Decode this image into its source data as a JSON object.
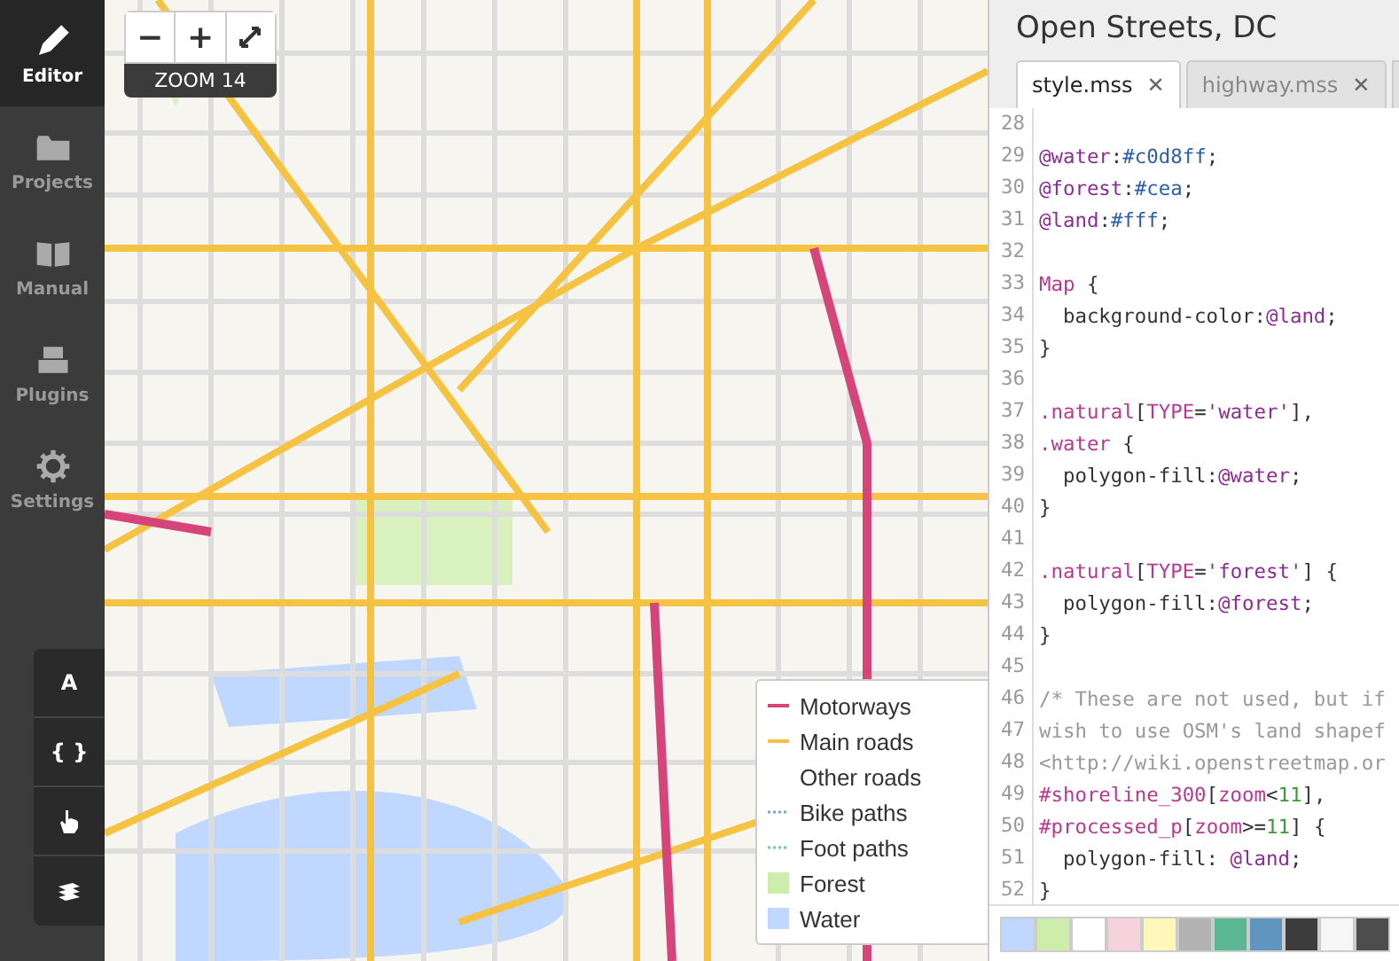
{
  "sidebar": {
    "items": [
      {
        "label": "Editor",
        "selected": true
      },
      {
        "label": "Projects",
        "selected": false
      },
      {
        "label": "Manual",
        "selected": false
      },
      {
        "label": "Plugins",
        "selected": false
      },
      {
        "label": "Settings",
        "selected": false
      }
    ],
    "tools": [
      {
        "kind": "text",
        "label": "A"
      },
      {
        "kind": "text",
        "label": "{ }"
      },
      {
        "kind": "hand"
      },
      {
        "kind": "layers"
      }
    ]
  },
  "map": {
    "zoom_controls": {
      "zoom_out": "−",
      "zoom_in": "+",
      "zoom_label": "ZOOM 14"
    },
    "legend": [
      {
        "label": "Motorways",
        "kind": "line",
        "color": "#d6457a"
      },
      {
        "label": "Main roads",
        "kind": "line",
        "color": "#f5c242"
      },
      {
        "label": "Other roads",
        "kind": "none"
      },
      {
        "label": "Bike paths",
        "kind": "dotted",
        "color": "#7aa6c8"
      },
      {
        "label": "Foot paths",
        "kind": "dotted",
        "color": "#7cc4a4"
      },
      {
        "label": "Forest",
        "kind": "fill",
        "color": "#cceeaa"
      },
      {
        "label": "Water",
        "kind": "fill",
        "color": "#c0d8ff"
      }
    ]
  },
  "editor": {
    "title": "Open Streets, DC",
    "tabs": [
      {
        "label": "style.mss",
        "close": "✕",
        "selected": true
      },
      {
        "label": "highway.mss",
        "close": "✕",
        "selected": false
      }
    ],
    "lines": [
      {
        "number": "28"
      },
      {
        "number": "29",
        "tokens": [
          {
            "kind": "var",
            "text": "@water"
          },
          {
            "kind": "plain",
            "text": ":"
          },
          {
            "kind": "value",
            "text": "#c0d8ff"
          },
          {
            "kind": "plain",
            "text": ";"
          }
        ]
      },
      {
        "number": "30",
        "tokens": [
          {
            "kind": "var",
            "text": "@forest"
          },
          {
            "kind": "plain",
            "text": ":"
          },
          {
            "kind": "value",
            "text": "#cea"
          },
          {
            "kind": "plain",
            "text": ";"
          }
        ]
      },
      {
        "number": "31",
        "tokens": [
          {
            "kind": "var",
            "text": "@land"
          },
          {
            "kind": "plain",
            "text": ":"
          },
          {
            "kind": "value",
            "text": "#fff"
          },
          {
            "kind": "plain",
            "text": ";"
          }
        ]
      },
      {
        "number": "32"
      },
      {
        "number": "33",
        "tokens": [
          {
            "kind": "selector",
            "text": "Map"
          },
          {
            "kind": "plain",
            "text": " {"
          }
        ]
      },
      {
        "number": "34",
        "tokens": [
          {
            "kind": "plain",
            "text": "  background-color:"
          },
          {
            "kind": "var",
            "text": "@land"
          },
          {
            "kind": "plain",
            "text": ";"
          }
        ]
      },
      {
        "number": "35",
        "tokens": [
          {
            "kind": "plain",
            "text": "}"
          }
        ]
      },
      {
        "number": "36"
      },
      {
        "number": "37",
        "tokens": [
          {
            "kind": "selector",
            "text": ".natural"
          },
          {
            "kind": "plain",
            "text": "["
          },
          {
            "kind": "selector",
            "text": "TYPE"
          },
          {
            "kind": "plain",
            "text": "="
          },
          {
            "kind": "string",
            "text": "'water'"
          },
          {
            "kind": "plain",
            "text": "],"
          }
        ]
      },
      {
        "number": "38",
        "tokens": [
          {
            "kind": "selector",
            "text": ".water"
          },
          {
            "kind": "plain",
            "text": " {"
          }
        ]
      },
      {
        "number": "39",
        "tokens": [
          {
            "kind": "plain",
            "text": "  polygon-fill:"
          },
          {
            "kind": "var",
            "text": "@water"
          },
          {
            "kind": "plain",
            "text": ";"
          }
        ]
      },
      {
        "number": "40",
        "tokens": [
          {
            "kind": "plain",
            "text": "}"
          }
        ]
      },
      {
        "number": "41"
      },
      {
        "number": "42",
        "tokens": [
          {
            "kind": "selector",
            "text": ".natural"
          },
          {
            "kind": "plain",
            "text": "["
          },
          {
            "kind": "selector",
            "text": "TYPE"
          },
          {
            "kind": "plain",
            "text": "="
          },
          {
            "kind": "string",
            "text": "'forest'"
          },
          {
            "kind": "plain",
            "text": "] {"
          }
        ]
      },
      {
        "number": "43",
        "tokens": [
          {
            "kind": "plain",
            "text": "  polygon-fill:"
          },
          {
            "kind": "var",
            "text": "@forest"
          },
          {
            "kind": "plain",
            "text": ";"
          }
        ]
      },
      {
        "number": "44",
        "tokens": [
          {
            "kind": "plain",
            "text": "}"
          }
        ]
      },
      {
        "number": "45"
      },
      {
        "number": "46",
        "tokens": [
          {
            "kind": "comment",
            "text": "/* These are not used, but if"
          }
        ]
      },
      {
        "number": "47",
        "tokens": [
          {
            "kind": "comment",
            "text": "wish to use OSM's land shapef"
          }
        ]
      },
      {
        "number": "48",
        "tokens": [
          {
            "kind": "comment",
            "text": "<http://wiki.openstreetmap.or"
          }
        ]
      },
      {
        "number": "49",
        "tokens": [
          {
            "kind": "selector",
            "text": "#shoreline_300"
          },
          {
            "kind": "plain",
            "text": "["
          },
          {
            "kind": "selector",
            "text": "zoom"
          },
          {
            "kind": "plain",
            "text": "<"
          },
          {
            "kind": "number",
            "text": "11"
          },
          {
            "kind": "plain",
            "text": "],"
          }
        ]
      },
      {
        "number": "50",
        "tokens": [
          {
            "kind": "selector",
            "text": "#processed_p"
          },
          {
            "kind": "plain",
            "text": "["
          },
          {
            "kind": "selector",
            "text": "zoom"
          },
          {
            "kind": "plain",
            "text": ">="
          },
          {
            "kind": "number",
            "text": "11"
          },
          {
            "kind": "plain",
            "text": "] {"
          }
        ]
      },
      {
        "number": "51",
        "tokens": [
          {
            "kind": "plain",
            "text": "  polygon-fill: "
          },
          {
            "kind": "var",
            "text": "@land"
          },
          {
            "kind": "plain",
            "text": ";"
          }
        ]
      },
      {
        "number": "52",
        "tokens": [
          {
            "kind": "plain",
            "text": "}"
          }
        ]
      }
    ],
    "palette": [
      {
        "color": "#c0d8ff"
      },
      {
        "color": "#cceeaa"
      },
      {
        "color": "#ffffff"
      },
      {
        "color": "#f5d3dd"
      },
      {
        "color": "#fff8b8"
      },
      {
        "color": "#b3b3b3"
      },
      {
        "color": "#5cb894"
      },
      {
        "color": "#6095be"
      },
      {
        "color": "#3c3c3c"
      },
      {
        "color": "#f6f6f6"
      },
      {
        "color": "#4d4d4d"
      }
    ]
  }
}
